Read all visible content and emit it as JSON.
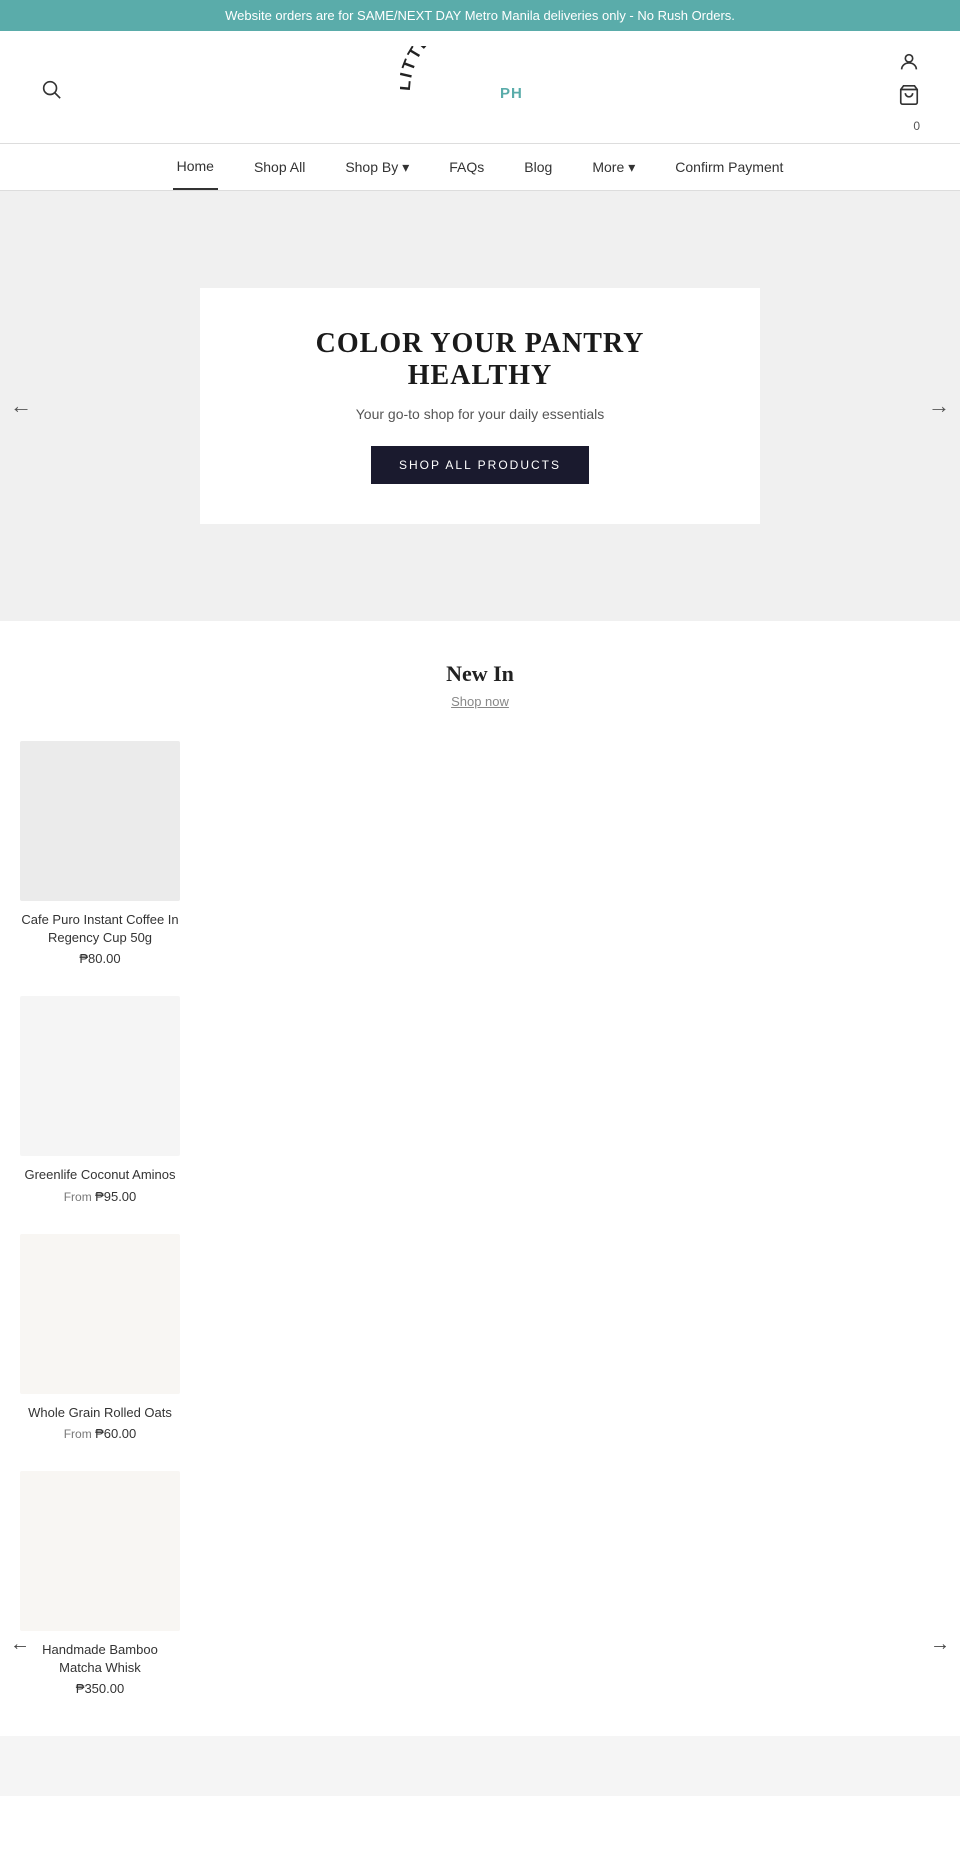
{
  "announcement": {
    "text": "Website orders are for SAME/NEXT DAY Metro Manila deliveries only - No Rush Orders."
  },
  "header": {
    "logo": "LITTLERETAILPH",
    "logo_main": "LITTLERETAIL",
    "logo_sub": "PH",
    "cart_count": "0"
  },
  "nav": {
    "items": [
      {
        "label": "Home",
        "active": true,
        "has_dropdown": false
      },
      {
        "label": "Shop All",
        "active": false,
        "has_dropdown": false
      },
      {
        "label": "Shop By",
        "active": false,
        "has_dropdown": true
      },
      {
        "label": "FAQs",
        "active": false,
        "has_dropdown": false
      },
      {
        "label": "Blog",
        "active": false,
        "has_dropdown": false
      },
      {
        "label": "More",
        "active": false,
        "has_dropdown": true
      },
      {
        "label": "Confirm Payment",
        "active": false,
        "has_dropdown": false
      }
    ]
  },
  "hero": {
    "title": "COLOR YOUR PANTRY HEALTHY",
    "subtitle": "Your go-to shop for your daily essentials",
    "button_label": "SHOP ALL PRODUCTS"
  },
  "new_in": {
    "title": "New In",
    "link_label": "Shop now"
  },
  "products": [
    {
      "name": "Cafe Puro Instant Coffee In Regency Cup 50g",
      "price": "₱80.00",
      "from_prefix": "",
      "image_shade": "light-gray"
    },
    {
      "name": "Greenlife Coconut Aminos",
      "price": "₱95.00",
      "from_prefix": "From ",
      "image_shade": "lighter"
    },
    {
      "name": "Whole Grain Rolled Oats",
      "price": "₱60.00",
      "from_prefix": "From ",
      "image_shade": "lightest"
    },
    {
      "name": "Handmade Bamboo Matcha Whisk",
      "price": "₱350.00",
      "from_prefix": "",
      "image_shade": "lightest"
    }
  ],
  "carousel": {
    "left_arrow": "←",
    "right_arrow": "→"
  }
}
